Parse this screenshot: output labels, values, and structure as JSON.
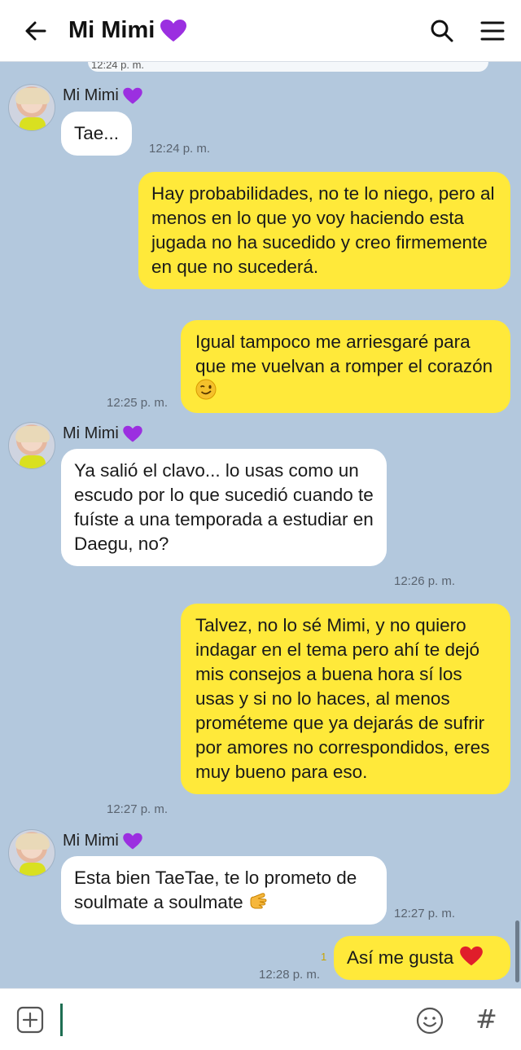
{
  "header": {
    "title": "Mi Mimi",
    "back_icon": "arrow-left-icon",
    "search_icon": "search-icon",
    "menu_icon": "hamburger-menu-icon"
  },
  "chat": {
    "clipped_previous": {
      "time": "12:24 p. m."
    },
    "messages": [
      {
        "id": "m1",
        "direction": "incoming",
        "sender": "Mi Mimi",
        "text": "Tae...",
        "time": "12:24 p. m."
      },
      {
        "id": "m2",
        "direction": "outgoing",
        "text": "Hay probabilidades, no te lo niego, pero al menos en lo que yo voy haciendo esta jugada no ha sucedido y creo firmemente en que no sucederá.",
        "time": ""
      },
      {
        "id": "m3",
        "direction": "outgoing",
        "text": "Igual tampoco me arriesgaré para que me vuelvan a romper el corazón",
        "time": "12:25 p. m.",
        "emoji": "winking-face"
      },
      {
        "id": "m4",
        "direction": "incoming",
        "sender": "Mi Mimi",
        "text": "Ya salió el clavo... lo usas como un escudo por lo que sucedió cuando te fuíste a una temporada a estudiar en Daegu, no?",
        "time": "12:26 p. m."
      },
      {
        "id": "m5",
        "direction": "outgoing",
        "text": "Talvez, no lo sé Mimi, y no quiero indagar en el tema pero ahí te dejó mis consejos a buena hora sí los usas y si no lo haces, al menos prométeme que ya dejarás de sufrir por amores no correspondidos, eres muy bueno para eso.",
        "time": "12:27 p. m."
      },
      {
        "id": "m6",
        "direction": "incoming",
        "sender": "Mi Mimi",
        "text": "Esta bien TaeTae, te lo prometo de soulmate a soulmate",
        "time": "12:27 p. m.",
        "emoji": "pointing-hand"
      },
      {
        "id": "m7",
        "direction": "outgoing",
        "text": "Así me gusta",
        "time": "12:28 p. m.",
        "read_count": "1",
        "emoji": "red-heart"
      }
    ]
  },
  "input_bar": {
    "add_icon": "plus-box-icon",
    "emoji_icon": "smiley-icon",
    "hash_icon": "#",
    "placeholder": ""
  },
  "colors": {
    "chat_bg": "#b3c8dd",
    "outgoing_bubble": "#ffe93a",
    "incoming_bubble": "#ffffff",
    "name_heart": "#9b2fe0"
  }
}
